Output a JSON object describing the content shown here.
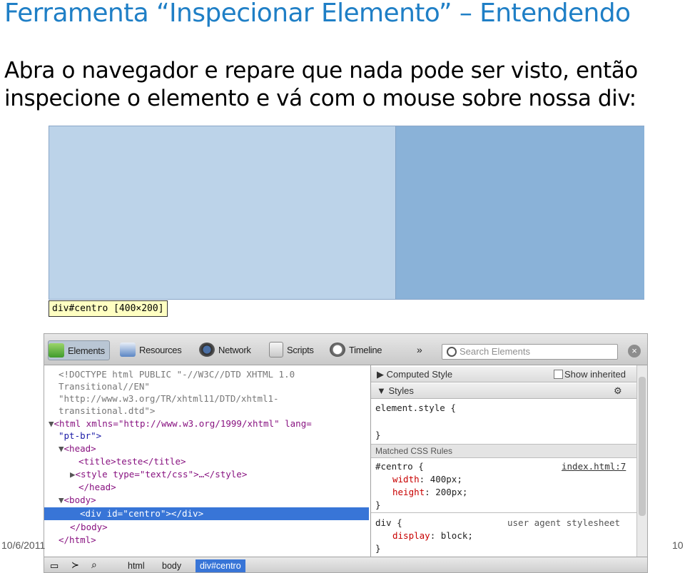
{
  "slide": {
    "title": "Ferramenta “Inspecionar Elemento” – Entendendo",
    "text": "Abra o navegador e repare que nada pode ser visto, então inspecione o elemento e vá com o mouse sobre nossa div:",
    "footer_date": "10/6/2011",
    "footer_page": "10"
  },
  "browser": {
    "tooltip": "div#centro [400×200]"
  },
  "devtools": {
    "tabs": [
      "Elements",
      "Resources",
      "Network",
      "Scripts",
      "Timeline"
    ],
    "more": "»",
    "search_placeholder": "Search Elements",
    "dom": {
      "l1": "<!DOCTYPE html PUBLIC \"-//W3C//DTD XHTML 1.0",
      "l2": "Transitional//EN\"",
      "l3": "\"http://www.w3.org/TR/xhtml11/DTD/xhtml1-",
      "l4": "transitional.dtd\">",
      "html_open": "<html xmlns=\"http://www.w3.org/1999/xhtml\" lang=",
      "html_lang": "\"pt-br\">",
      "head_open": "<head>",
      "title_line": "<title>teste</title>",
      "style_line": "<style type=\"text/css\">…</style>",
      "head_close": "</head>",
      "body_open": "<body>",
      "div_line": "<div id=\"centro\"></div>",
      "body_close": "</body>",
      "html_close": "</html>"
    },
    "side": {
      "computed": "Computed Style",
      "show_inherited": "Show inherited",
      "styles": "Styles",
      "element_style": "element.style {",
      "brace_close": "}",
      "matched": "Matched CSS Rules",
      "centro_sel": "#centro {",
      "centro_link": "index.html:7",
      "width_prop": "width",
      "width_val": "400px;",
      "height_prop": "height",
      "height_val": "200px;",
      "div_sel": "div {",
      "ua": "user agent stylesheet",
      "display_prop": "display",
      "display_val": "block;"
    },
    "breadcrumbs": [
      "html",
      "body",
      "div#centro"
    ]
  },
  "colors": {
    "title": "#1f7fc6",
    "selection": "#3875d7",
    "page_bg": "#bcd3e9",
    "div_bg": "#8ab2d8"
  }
}
